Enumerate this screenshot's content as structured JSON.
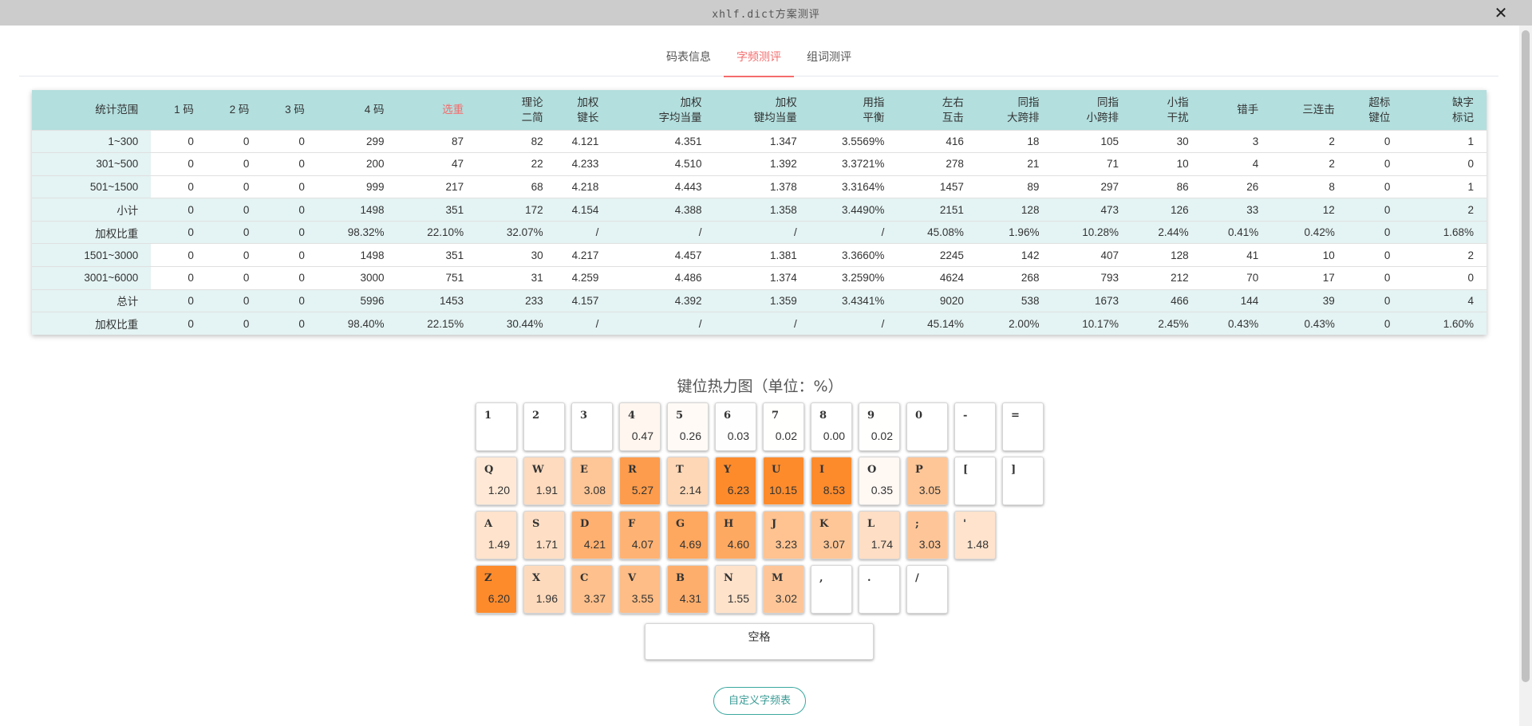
{
  "window": {
    "title": "xhlf.dict方案测评"
  },
  "tabs": [
    {
      "label": "码表信息",
      "active": false
    },
    {
      "label": "字频测评",
      "active": true
    },
    {
      "label": "组词测评",
      "active": false
    }
  ],
  "table": {
    "headers": [
      [
        "统计范围"
      ],
      [
        "1 码"
      ],
      [
        "2 码"
      ],
      [
        "3 码"
      ],
      [
        "4 码"
      ],
      [
        "选重"
      ],
      [
        "理论",
        "二简"
      ],
      [
        "加权",
        "键长"
      ],
      [
        "加权",
        "字均当量"
      ],
      [
        "加权",
        "键均当量"
      ],
      [
        "用指",
        "平衡"
      ],
      [
        "左右",
        "互击"
      ],
      [
        "同指",
        "大跨排"
      ],
      [
        "同指",
        "小跨排"
      ],
      [
        "小指",
        "干扰"
      ],
      [
        "错手"
      ],
      [
        "三连击"
      ],
      [
        "超标",
        "键位"
      ],
      [
        "缺字",
        "标记"
      ]
    ],
    "rows": [
      [
        "1~300",
        "0",
        "0",
        "0",
        "299",
        "87",
        "82",
        "4.121",
        "4.351",
        "1.347",
        "3.5569%",
        "416",
        "18",
        "105",
        "30",
        "3",
        "2",
        "0",
        "1"
      ],
      [
        "301~500",
        "0",
        "0",
        "0",
        "200",
        "47",
        "22",
        "4.233",
        "4.510",
        "1.392",
        "3.3721%",
        "278",
        "21",
        "71",
        "10",
        "4",
        "2",
        "0",
        "0"
      ],
      [
        "501~1500",
        "0",
        "0",
        "0",
        "999",
        "217",
        "68",
        "4.218",
        "4.443",
        "1.378",
        "3.3164%",
        "1457",
        "89",
        "297",
        "86",
        "26",
        "8",
        "0",
        "1"
      ],
      [
        "小计",
        "0",
        "0",
        "0",
        "1498",
        "351",
        "172",
        "4.154",
        "4.388",
        "1.358",
        "3.4490%",
        "2151",
        "128",
        "473",
        "126",
        "33",
        "12",
        "0",
        "2"
      ],
      [
        "加权比重",
        "0",
        "0",
        "0",
        "98.32%",
        "22.10%",
        "32.07%",
        "/",
        "/",
        "/",
        "/",
        "45.08%",
        "1.96%",
        "10.28%",
        "2.44%",
        "0.41%",
        "0.42%",
        "0",
        "1.68%"
      ],
      [
        "1501~3000",
        "0",
        "0",
        "0",
        "1498",
        "351",
        "30",
        "4.217",
        "4.457",
        "1.381",
        "3.3660%",
        "2245",
        "142",
        "407",
        "128",
        "41",
        "10",
        "0",
        "2"
      ],
      [
        "3001~6000",
        "0",
        "0",
        "0",
        "3000",
        "751",
        "31",
        "4.259",
        "4.486",
        "1.374",
        "3.2590%",
        "4624",
        "268",
        "793",
        "212",
        "70",
        "17",
        "0",
        "0"
      ],
      [
        "总计",
        "0",
        "0",
        "0",
        "5996",
        "1453",
        "233",
        "4.157",
        "4.392",
        "1.359",
        "3.4341%",
        "9020",
        "538",
        "1673",
        "466",
        "144",
        "39",
        "0",
        "4"
      ],
      [
        "加权比重",
        "0",
        "0",
        "0",
        "98.40%",
        "22.15%",
        "30.44%",
        "/",
        "/",
        "/",
        "/",
        "45.14%",
        "2.00%",
        "10.17%",
        "2.45%",
        "0.43%",
        "0.43%",
        "0",
        "1.60%"
      ]
    ],
    "row_styles": [
      "plain",
      "plain",
      "plain",
      "hl",
      "wt",
      "plain",
      "plain",
      "hl",
      "wt"
    ]
  },
  "heatmap": {
    "title": "键位热力图（单位：%）",
    "colors": {
      "low": "#ffffff",
      "high": "#fd8b2c"
    },
    "rows": [
      [
        {
          "key": "1",
          "value": null
        },
        {
          "key": "2",
          "value": null
        },
        {
          "key": "3",
          "value": null
        },
        {
          "key": "4",
          "value": "0.47"
        },
        {
          "key": "5",
          "value": "0.26"
        },
        {
          "key": "6",
          "value": "0.03"
        },
        {
          "key": "7",
          "value": "0.02"
        },
        {
          "key": "8",
          "value": "0.00"
        },
        {
          "key": "9",
          "value": "0.02"
        },
        {
          "key": "0",
          "value": null
        },
        {
          "key": "-",
          "value": null
        },
        {
          "key": "=",
          "value": null
        }
      ],
      [
        {
          "key": "Q",
          "value": "1.20"
        },
        {
          "key": "W",
          "value": "1.91"
        },
        {
          "key": "E",
          "value": "3.08"
        },
        {
          "key": "R",
          "value": "5.27"
        },
        {
          "key": "T",
          "value": "2.14"
        },
        {
          "key": "Y",
          "value": "6.23"
        },
        {
          "key": "U",
          "value": "10.15"
        },
        {
          "key": "I",
          "value": "8.53"
        },
        {
          "key": "O",
          "value": "0.35"
        },
        {
          "key": "P",
          "value": "3.05"
        },
        {
          "key": "[",
          "value": null
        },
        {
          "key": "]",
          "value": null
        }
      ],
      [
        {
          "key": "A",
          "value": "1.49"
        },
        {
          "key": "S",
          "value": "1.71"
        },
        {
          "key": "D",
          "value": "4.21"
        },
        {
          "key": "F",
          "value": "4.07"
        },
        {
          "key": "G",
          "value": "4.69"
        },
        {
          "key": "H",
          "value": "4.60"
        },
        {
          "key": "J",
          "value": "3.23"
        },
        {
          "key": "K",
          "value": "3.07"
        },
        {
          "key": "L",
          "value": "1.74"
        },
        {
          "key": ";",
          "value": "3.03"
        },
        {
          "key": "'",
          "value": "1.48"
        }
      ],
      [
        {
          "key": "Z",
          "value": "6.20"
        },
        {
          "key": "X",
          "value": "1.96"
        },
        {
          "key": "C",
          "value": "3.37"
        },
        {
          "key": "V",
          "value": "3.55"
        },
        {
          "key": "B",
          "value": "4.31"
        },
        {
          "key": "N",
          "value": "1.55"
        },
        {
          "key": "M",
          "value": "3.02"
        },
        {
          "key": ",",
          "value": null
        },
        {
          "key": ".",
          "value": null
        },
        {
          "key": "/",
          "value": null
        }
      ]
    ],
    "space_label": "空格"
  },
  "custom_button": "自定义字频表"
}
